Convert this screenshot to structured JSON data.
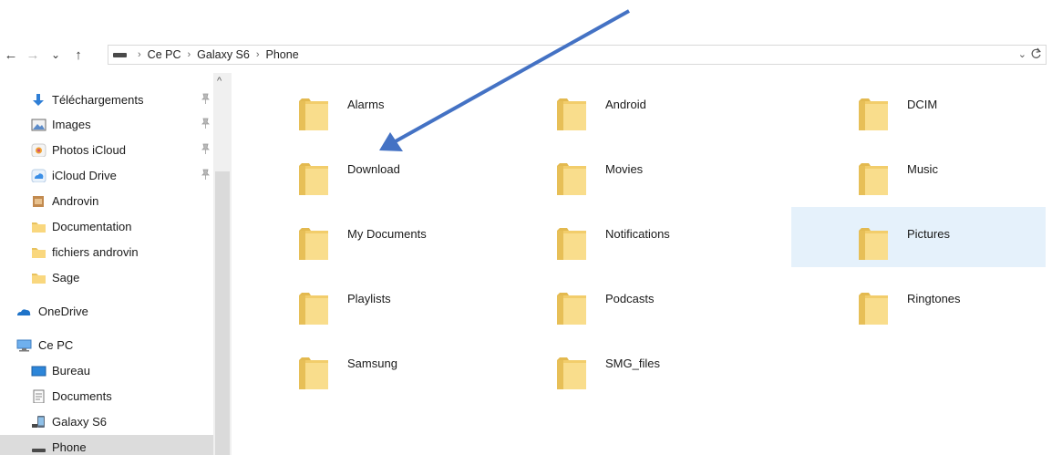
{
  "nav": {
    "back": "←",
    "forward": "→",
    "recent": "⌄",
    "up": "↑",
    "separator": "›",
    "breadcrumbs": [
      "Ce PC",
      "Galaxy S6",
      "Phone"
    ],
    "dropdown": "⌄"
  },
  "sidebar": {
    "scroll_up": "^",
    "items": [
      {
        "label": "Téléchargements",
        "icon": "download-arrow-icon",
        "pinned": true
      },
      {
        "label": "Images",
        "icon": "images-icon",
        "pinned": true
      },
      {
        "label": "Photos iCloud",
        "icon": "photos-icloud-icon",
        "pinned": true
      },
      {
        "label": "iCloud Drive",
        "icon": "icloud-drive-icon",
        "pinned": true
      },
      {
        "label": "Androvin",
        "icon": "androvin-folder-icon",
        "pinned": false
      },
      {
        "label": "Documentation",
        "icon": "folder-icon",
        "pinned": false
      },
      {
        "label": "fichiers androvin",
        "icon": "folder-icon",
        "pinned": false
      },
      {
        "label": "Sage",
        "icon": "folder-icon",
        "pinned": false
      },
      {
        "label": "OneDrive",
        "icon": "onedrive-cloud-icon",
        "pinned": false
      },
      {
        "label": "Ce PC",
        "icon": "computer-icon",
        "pinned": false
      },
      {
        "label": "Bureau",
        "icon": "desktop-icon",
        "pinned": false
      },
      {
        "label": "Documents",
        "icon": "documents-icon",
        "pinned": false
      },
      {
        "label": "Galaxy S6",
        "icon": "phone-device-icon",
        "pinned": false
      },
      {
        "label": "Phone",
        "icon": "storage-drive-icon",
        "pinned": false
      }
    ],
    "selected": "Phone"
  },
  "folders": [
    {
      "name": "Alarms"
    },
    {
      "name": "Android"
    },
    {
      "name": "DCIM"
    },
    {
      "name": "Download"
    },
    {
      "name": "Movies"
    },
    {
      "name": "Music"
    },
    {
      "name": "My Documents"
    },
    {
      "name": "Notifications"
    },
    {
      "name": "Pictures"
    },
    {
      "name": "Playlists"
    },
    {
      "name": "Podcasts"
    },
    {
      "name": "Ringtones"
    },
    {
      "name": "Samsung"
    },
    {
      "name": "SMG_files"
    }
  ],
  "selected_folder": "Pictures",
  "annotation": {
    "color": "#4472c4",
    "points_to": "Download"
  }
}
